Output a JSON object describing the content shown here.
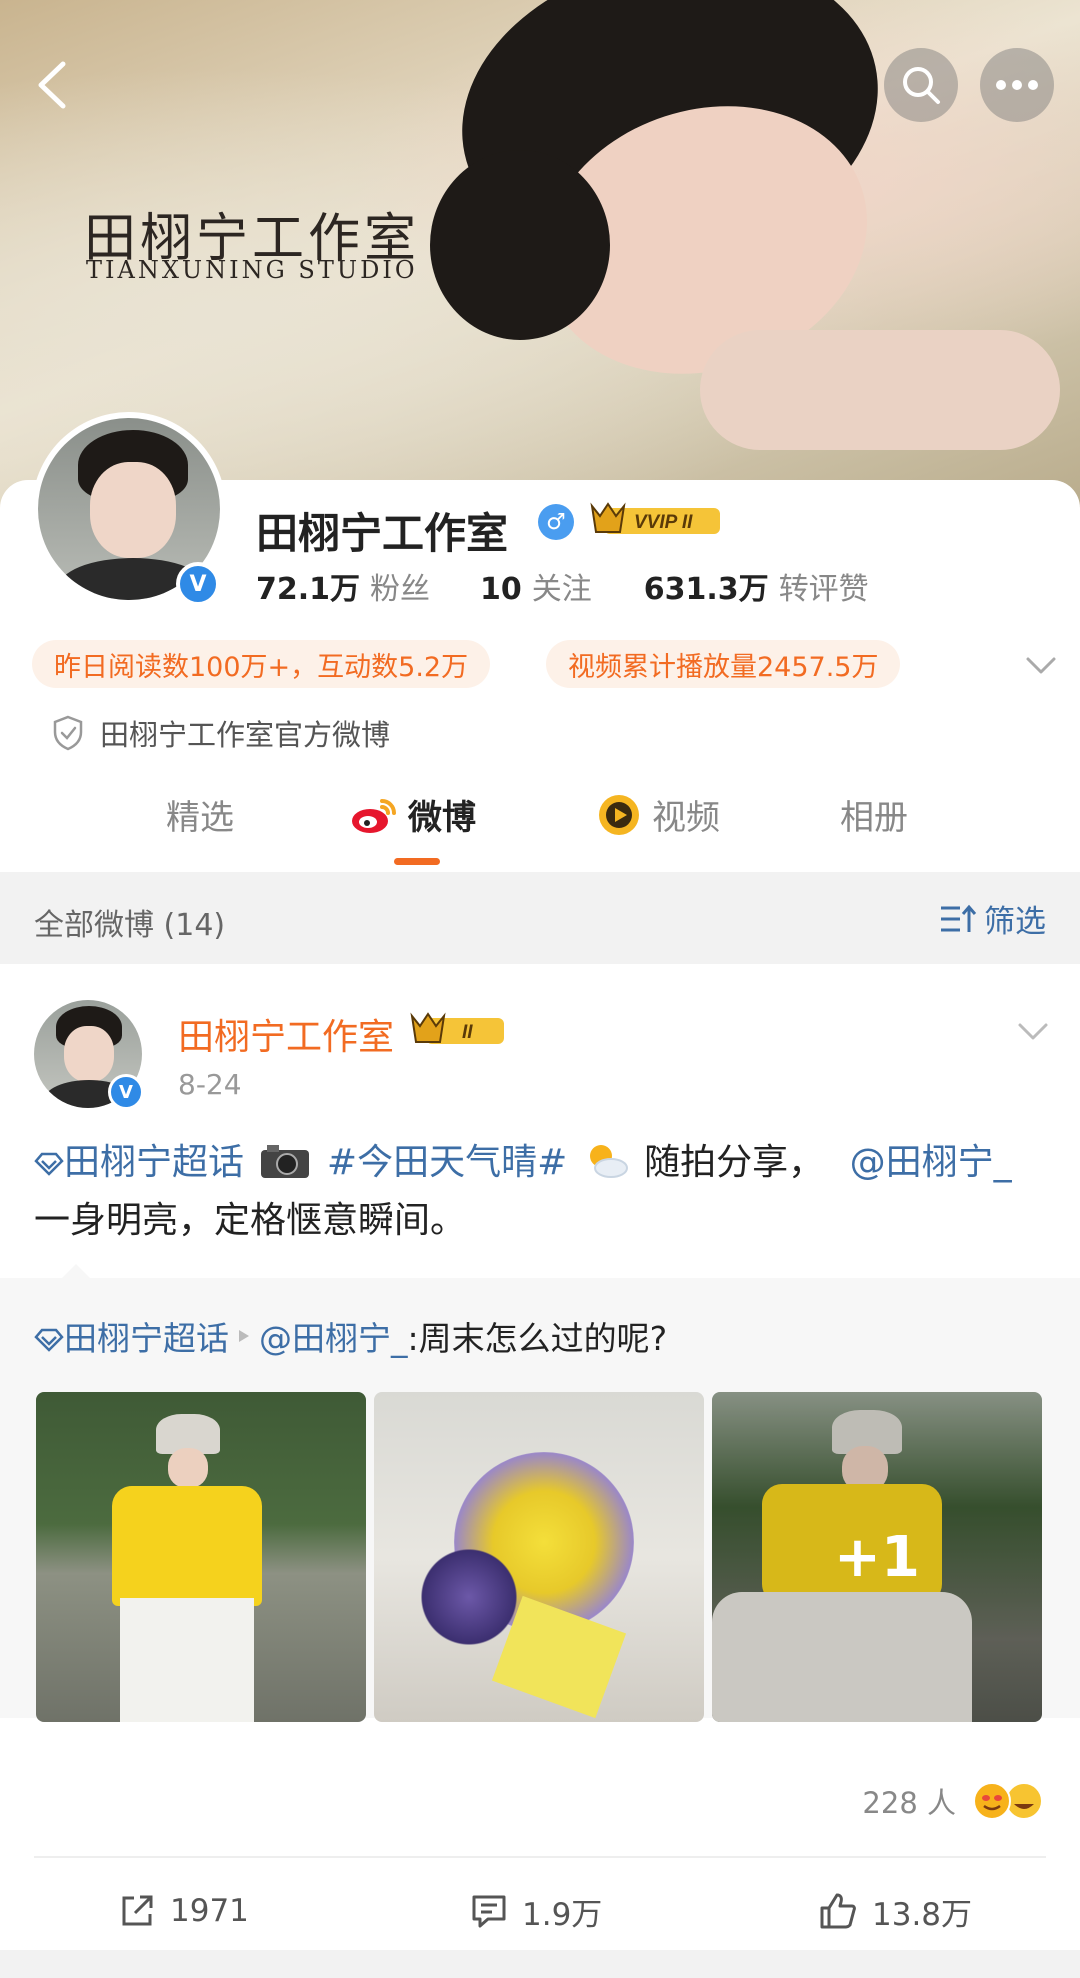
{
  "header": {
    "banner_title_cn": "田栩宁工作室",
    "banner_title_en": "TIANXUNING STUDIO"
  },
  "profile": {
    "name": "田栩宁工作室",
    "vip_label": "VVIP II",
    "stats": [
      {
        "value": "72.1万",
        "label": "粉丝"
      },
      {
        "value": "10",
        "label": "关注"
      },
      {
        "value": "631.3万",
        "label": "转评赞"
      }
    ],
    "pills": [
      "昨日阅读数100万+，互动数5.2万",
      "视频累计播放量2457.5万"
    ],
    "official_text": "田栩宁工作室官方微博"
  },
  "tabs": [
    {
      "label": "精选"
    },
    {
      "label": "微博"
    },
    {
      "label": "视频"
    },
    {
      "label": "相册"
    }
  ],
  "filter": {
    "count_label": "全部微博 (14)",
    "button_label": "筛选"
  },
  "post": {
    "author": "田栩宁工作室",
    "badge_label": "II",
    "date": "8-24",
    "text": {
      "super_topic": "田栩宁超话",
      "hashtag": "#今田天气晴#",
      "body_1": "随拍分享，",
      "mention": "@田栩宁_",
      "body_2": "一身明亮，定格惬意瞬间。"
    },
    "repost": {
      "super_topic": "田栩宁超话",
      "mention": "@田栩宁_",
      "text": ":周末怎么过的呢?"
    },
    "extra_photos": "+1",
    "likes_count": "228 人",
    "actions": {
      "share": "1971",
      "comment": "1.9万",
      "like": "13.8万"
    }
  }
}
